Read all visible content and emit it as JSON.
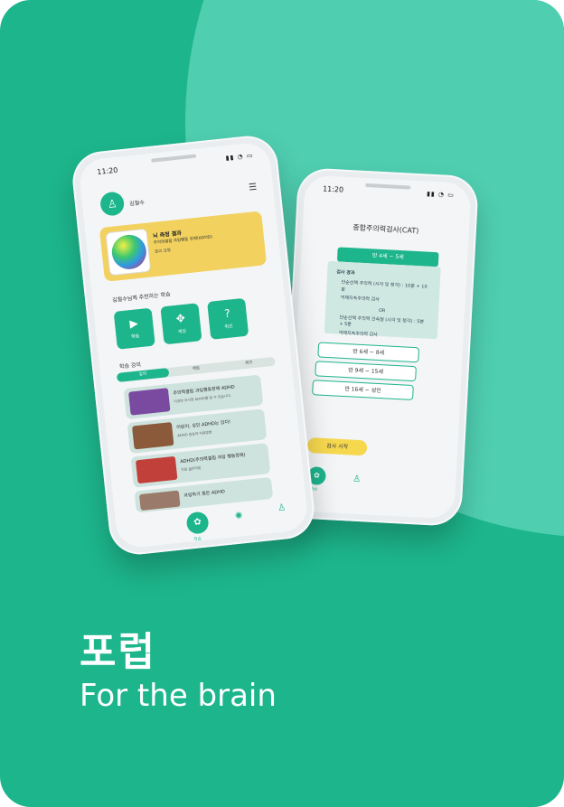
{
  "colors": {
    "brand": "#1db58c",
    "light_green": "#4fceb0",
    "yellow": "#f2d15f"
  },
  "app": {
    "title": "포럽",
    "subtitle": "For the brain"
  },
  "front": {
    "status_time": "11:20",
    "user_name": "김철수",
    "result_card": {
      "title": "뇌 측정 결과",
      "subtitle": "주의력결핍 과잉행동 장애(ADHD)",
      "more": "결과 설명"
    },
    "recommend_title": "김철수님께 추천하는 학습",
    "quick_buttons": [
      {
        "icon": "play-icon",
        "label": "학습"
      },
      {
        "icon": "gamepad-icon",
        "label": "게임"
      },
      {
        "icon": "quiz-icon",
        "label": "퀴즈"
      }
    ],
    "lecture_title": "학습 강의",
    "tabs": [
      "강의",
      "게임",
      "퀴즈"
    ],
    "lectures": [
      {
        "title": "주의력결핍 과잉행동장애 ADHD",
        "sub": "이것만 아시면 ADHD를 알 수 있습니다."
      },
      {
        "title": "어린이, 성인 ADHD는 있다!",
        "sub": "ADHD 증상과 치료방법"
      },
      {
        "title": "ADHD(주의력결핍 과잉 행동장애)",
        "sub": "치료 골든타임"
      },
      {
        "title": "과잉하기 힘든 ADHD",
        "sub": ""
      }
    ],
    "nav": {
      "learn_label": "학습"
    }
  },
  "back": {
    "status_time": "11:20",
    "title": "종합주의력검사(CAT)",
    "age_tab": "만 4세 ~ 5세",
    "info": {
      "title": "검사 경과",
      "line1": "단순선택 주의력 (시각 및 청각) : 10분 + 10분",
      "line2": "억제지속주의력 검사",
      "or": "OR",
      "line3": "단순선택 주의력 간속형 (시각 및 청각) : 5분 + 5분",
      "line4": "억제지속주의력 검사"
    },
    "ages": [
      "만 6세 ~ 8세",
      "만 9세 ~ 15세",
      "만 16세 ~ 성인"
    ],
    "test_button": "검사 시작",
    "nav_learn_label": "학습"
  }
}
